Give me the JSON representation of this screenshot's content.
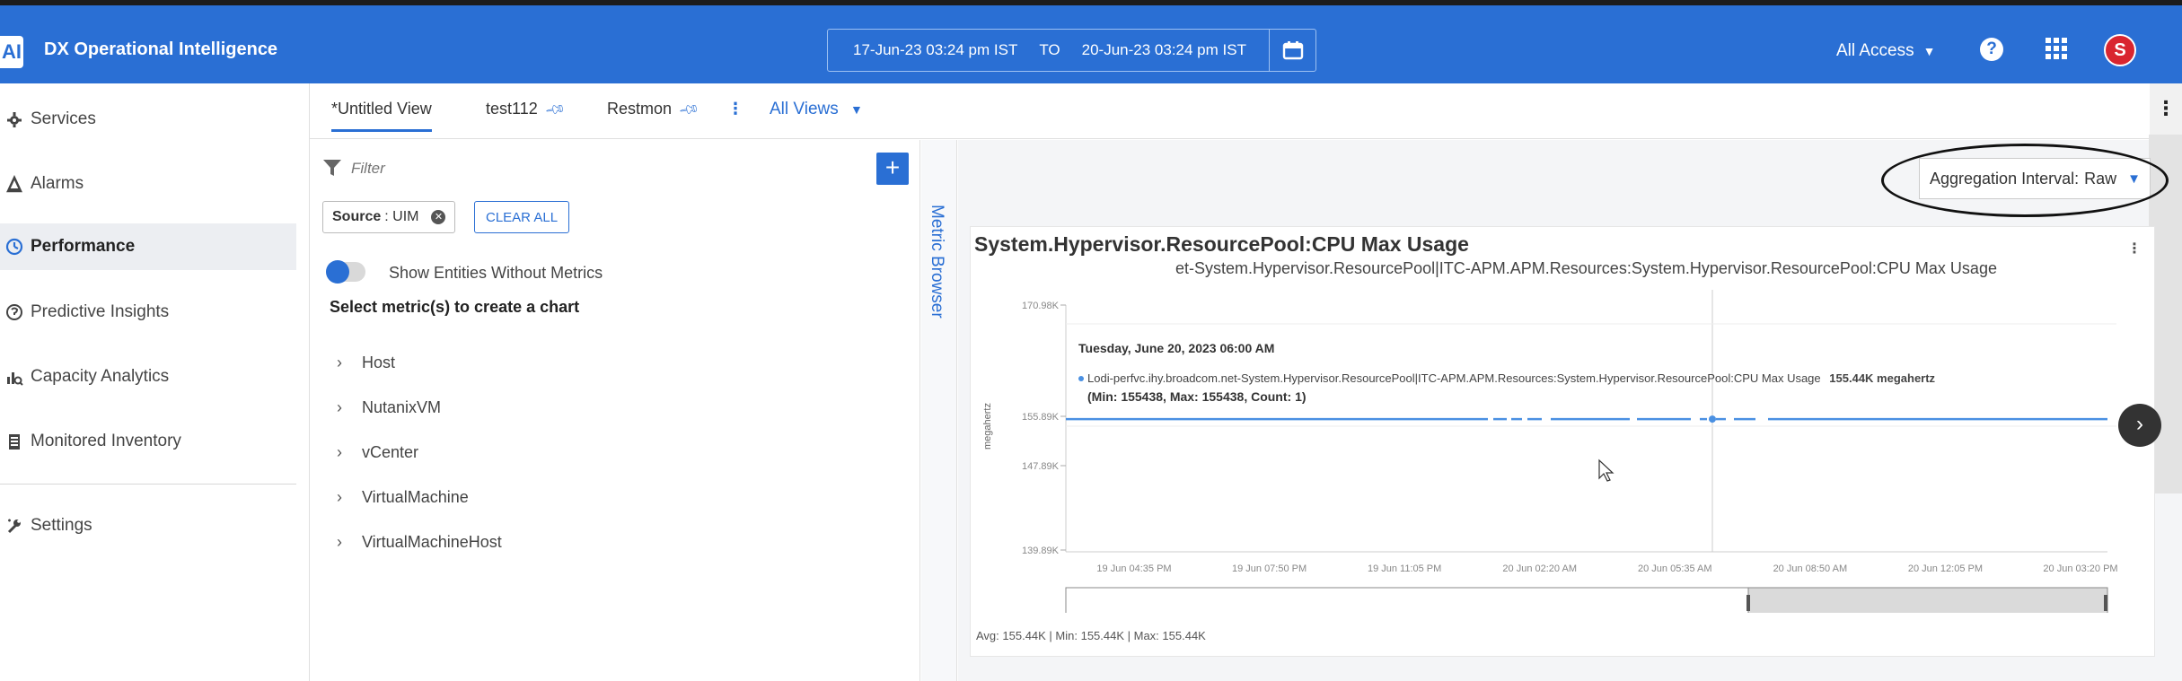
{
  "header": {
    "logo_text": "AI",
    "app_title": "DX Operational Intelligence",
    "date_from": "17-Jun-23 03:24 pm IST",
    "date_to_label": "TO",
    "date_to": "20-Jun-23 03:24 pm IST",
    "access_label": "All Access",
    "help_label": "?",
    "avatar_initial": "S",
    "brand_color": "#2a6fd4"
  },
  "sidebar": {
    "items": [
      {
        "label": "Services",
        "icon": "gear-icon"
      },
      {
        "label": "Alarms",
        "icon": "alarm-icon"
      },
      {
        "label": "Performance",
        "icon": "performance-icon",
        "active": true
      },
      {
        "label": "Predictive Insights",
        "icon": "insights-icon"
      },
      {
        "label": "Capacity Analytics",
        "icon": "capacity-icon"
      },
      {
        "label": "Monitored Inventory",
        "icon": "inventory-icon"
      },
      {
        "label": "Settings",
        "icon": "settings-icon"
      }
    ]
  },
  "tabs": {
    "items": [
      {
        "label": "*Untitled View",
        "active": true
      },
      {
        "label": "test112",
        "pinned": true
      },
      {
        "label": "Restmon",
        "pinned": true
      }
    ],
    "more_label": "⋮",
    "all_views_label": "All Views"
  },
  "filter_panel": {
    "placeholder": "Filter",
    "add_label": "+",
    "source_key": "Source",
    "source_value": ": UIM",
    "clear_label": "CLEAR ALL",
    "toggle_label": "Show Entities Without Metrics",
    "toggle_on": true,
    "select_hint": "Select metric(s) to create a chart",
    "tree": [
      "Host",
      "NutanixVM",
      "vCenter",
      "VirtualMachine",
      "VirtualMachineHost"
    ]
  },
  "metric_browser": {
    "label": "Metric Browser"
  },
  "aggregation": {
    "label": "Aggregation Interval:",
    "value": "Raw"
  },
  "chart": {
    "title": "System.Hypervisor.ResourcePool:CPU Max Usage",
    "subtitle": "et-System.Hypervisor.ResourcePool|ITC-APM.APM.Resources:System.Hypervisor.ResourcePool:CPU Max Usage",
    "tooltip_date": "Tuesday, June 20, 2023 06:00 AM",
    "tooltip_series": "Lodi-perfvc.ihy.broadcom.net-System.Hypervisor.ResourcePool|ITC-APM.APM.Resources:System.Hypervisor.ResourcePool:CPU Max Usage",
    "tooltip_value": "155.44K megahertz",
    "tooltip_stats": "(Min: 155438, Max: 155438, Count: 1)",
    "footer": "Avg: 155.44K | Min: 155.44K | Max: 155.44K",
    "next_label": "›"
  },
  "chart_data": {
    "type": "line",
    "ylabel": "megahertz",
    "yticks": [
      "170.98K",
      "155.89K",
      "147.89K",
      "139.89K"
    ],
    "ytick_values": [
      170980,
      155890,
      147890,
      139890
    ],
    "ylim": [
      139890,
      170980
    ],
    "xticks": [
      "19 Jun 04:35 PM",
      "19 Jun 07:50 PM",
      "19 Jun 11:05 PM",
      "20 Jun 02:20 AM",
      "20 Jun 05:35 AM",
      "20 Jun 08:50 AM",
      "20 Jun 12:05 PM",
      "20 Jun 03:20 PM"
    ],
    "series": [
      {
        "name": "Lodi-perfvc.ihy.broadcom.net-System.Hypervisor.ResourcePool|ITC-APM.APM.Resources:System.Hypervisor.ResourcePool:CPU Max Usage",
        "value": 155438,
        "color": "#4a90e2"
      }
    ],
    "grid": true
  }
}
